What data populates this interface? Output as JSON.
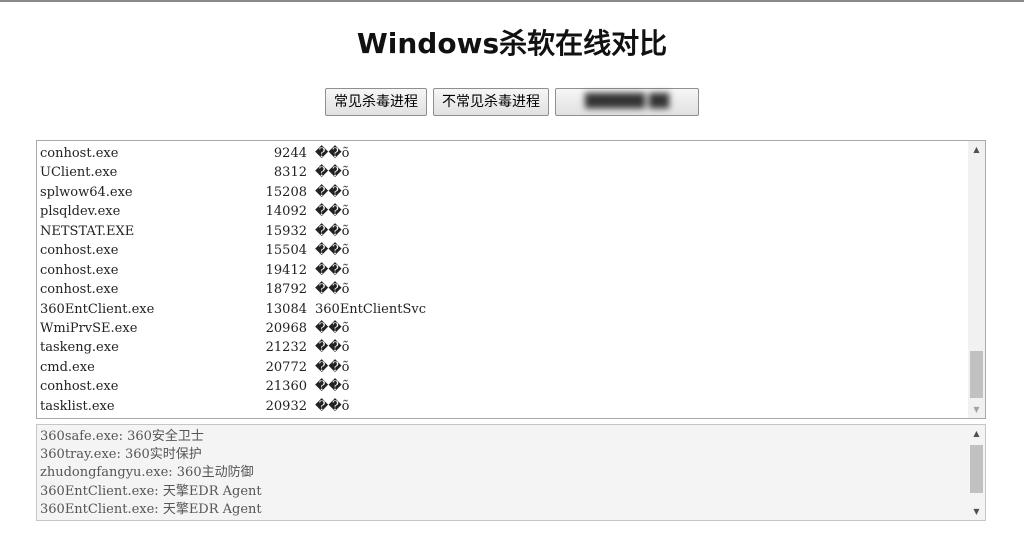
{
  "page": {
    "title": "Windows杀软在线对比"
  },
  "buttons": {
    "common_av": "常见杀毒进程",
    "uncommon_av": "不常见杀毒进程",
    "third": "██████ ██"
  },
  "process_list": {
    "rows": [
      {
        "name": "conhost.exe",
        "pid": "9244",
        "service": "��õ"
      },
      {
        "name": "UClient.exe",
        "pid": "8312",
        "service": "��õ"
      },
      {
        "name": "splwow64.exe",
        "pid": "15208",
        "service": "��õ"
      },
      {
        "name": "plsqldev.exe",
        "pid": "14092",
        "service": "��õ"
      },
      {
        "name": "NETSTAT.EXE",
        "pid": "15932",
        "service": "��õ"
      },
      {
        "name": "conhost.exe",
        "pid": "15504",
        "service": "��õ"
      },
      {
        "name": "conhost.exe",
        "pid": "19412",
        "service": "��õ"
      },
      {
        "name": "conhost.exe",
        "pid": "18792",
        "service": "��õ"
      },
      {
        "name": "360EntClient.exe",
        "pid": "13084",
        "service": "360EntClientSvc"
      },
      {
        "name": "WmiPrvSE.exe",
        "pid": "20968",
        "service": "��õ"
      },
      {
        "name": "taskeng.exe",
        "pid": "21232",
        "service": "��õ"
      },
      {
        "name": "cmd.exe",
        "pid": "20772",
        "service": "��õ"
      },
      {
        "name": "conhost.exe",
        "pid": "21360",
        "service": "��õ"
      },
      {
        "name": "tasklist.exe",
        "pid": "20932",
        "service": "��õ"
      }
    ]
  },
  "results": {
    "lines": [
      "360safe.exe: 360安全卫士",
      "360tray.exe: 360实时保护",
      "zhudongfangyu.exe: 360主动防御",
      "360EntClient.exe: 天擎EDR Agent",
      "360EntClient.exe: 天擎EDR Agent"
    ]
  },
  "icons": {
    "scroll_up": "▲",
    "scroll_down": "▼"
  }
}
